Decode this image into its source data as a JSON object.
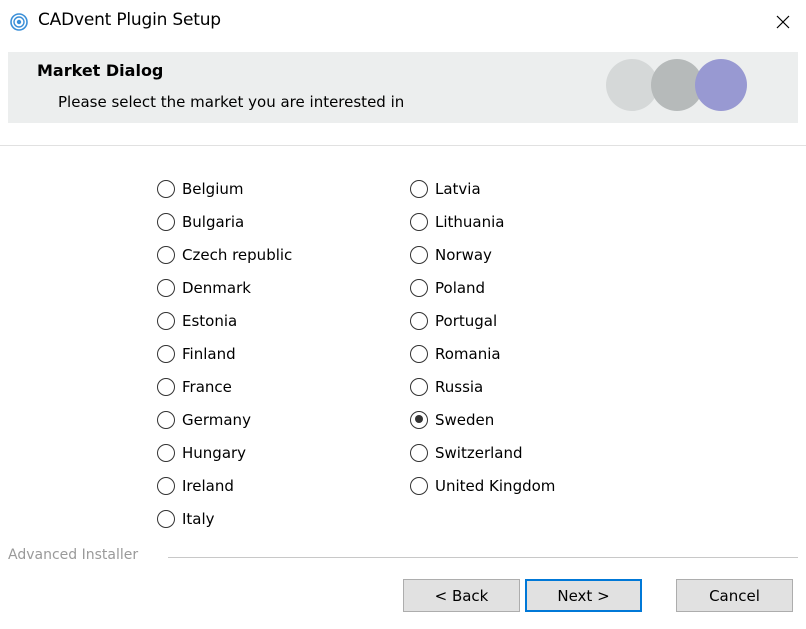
{
  "window": {
    "title": "CADvent Plugin Setup",
    "close_glyph": "×"
  },
  "header": {
    "title": "Market Dialog",
    "subtitle": "Please select the market you are interested in",
    "dot_colors": [
      "#d5d8d8",
      "#b6baba",
      "#9899d2"
    ]
  },
  "markets": {
    "column1": [
      {
        "label": "Belgium",
        "checked": false
      },
      {
        "label": "Bulgaria",
        "checked": false
      },
      {
        "label": "Czech republic",
        "checked": false
      },
      {
        "label": "Denmark",
        "checked": false
      },
      {
        "label": "Estonia",
        "checked": false
      },
      {
        "label": "Finland",
        "checked": false
      },
      {
        "label": "France",
        "checked": false
      },
      {
        "label": "Germany",
        "checked": false
      },
      {
        "label": "Hungary",
        "checked": false
      },
      {
        "label": "Ireland",
        "checked": false
      },
      {
        "label": "Italy",
        "checked": false
      }
    ],
    "column2": [
      {
        "label": "Latvia",
        "checked": false
      },
      {
        "label": "Lithuania",
        "checked": false
      },
      {
        "label": "Norway",
        "checked": false
      },
      {
        "label": "Poland",
        "checked": false
      },
      {
        "label": "Portugal",
        "checked": false
      },
      {
        "label": "Romania",
        "checked": false
      },
      {
        "label": "Russia",
        "checked": false
      },
      {
        "label": "Sweden",
        "checked": true
      },
      {
        "label": "Switzerland",
        "checked": false
      },
      {
        "label": "United Kingdom",
        "checked": false
      }
    ]
  },
  "footer": {
    "installer_label": "Advanced Installer",
    "back_label": "< Back",
    "next_label": "Next >",
    "cancel_label": "Cancel"
  },
  "colors": {
    "header_bg": "#eceeee",
    "focus_border": "#0078d7"
  }
}
